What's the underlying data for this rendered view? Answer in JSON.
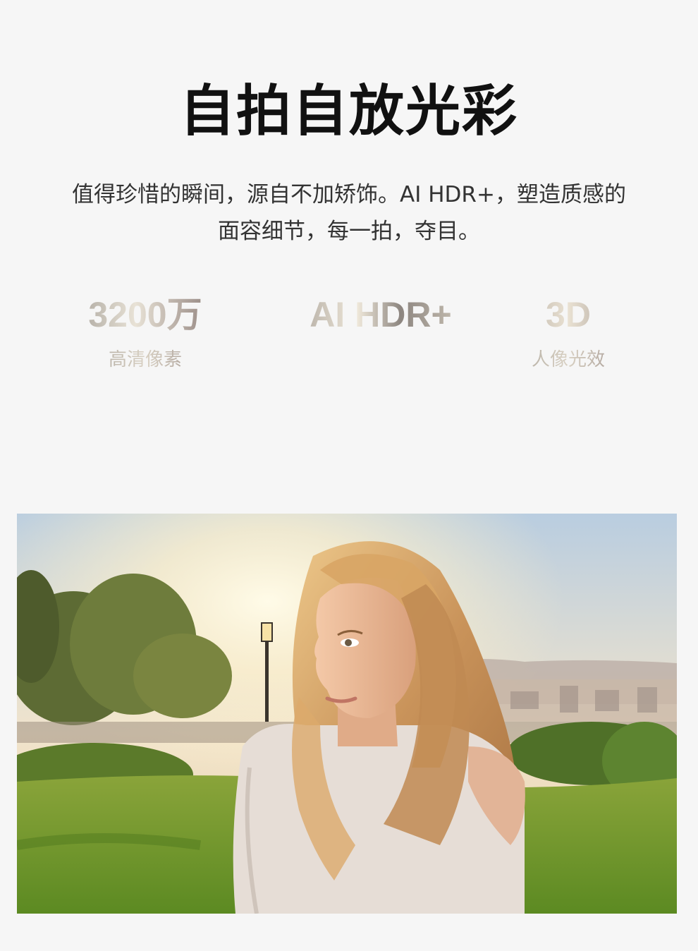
{
  "headline": "自拍自放光彩",
  "description": {
    "line1": "值得珍惜的瞬间，源自不加矫饰。AI HDR+，塑造质感的",
    "line2": "面容细节，每一拍，夺目。"
  },
  "stats": [
    {
      "value": "3200万",
      "label": "高清像素"
    },
    {
      "value": "AI HDR+",
      "label": ""
    },
    {
      "value": "3D",
      "label": "人像光效"
    }
  ],
  "photo": {
    "colors": {
      "sky_top": "#b8cde0",
      "sky_glow": "#fff4d6",
      "grass": "#6f9a2c",
      "hair": "#d7a86a",
      "sweater": "#e6ddd6"
    }
  }
}
